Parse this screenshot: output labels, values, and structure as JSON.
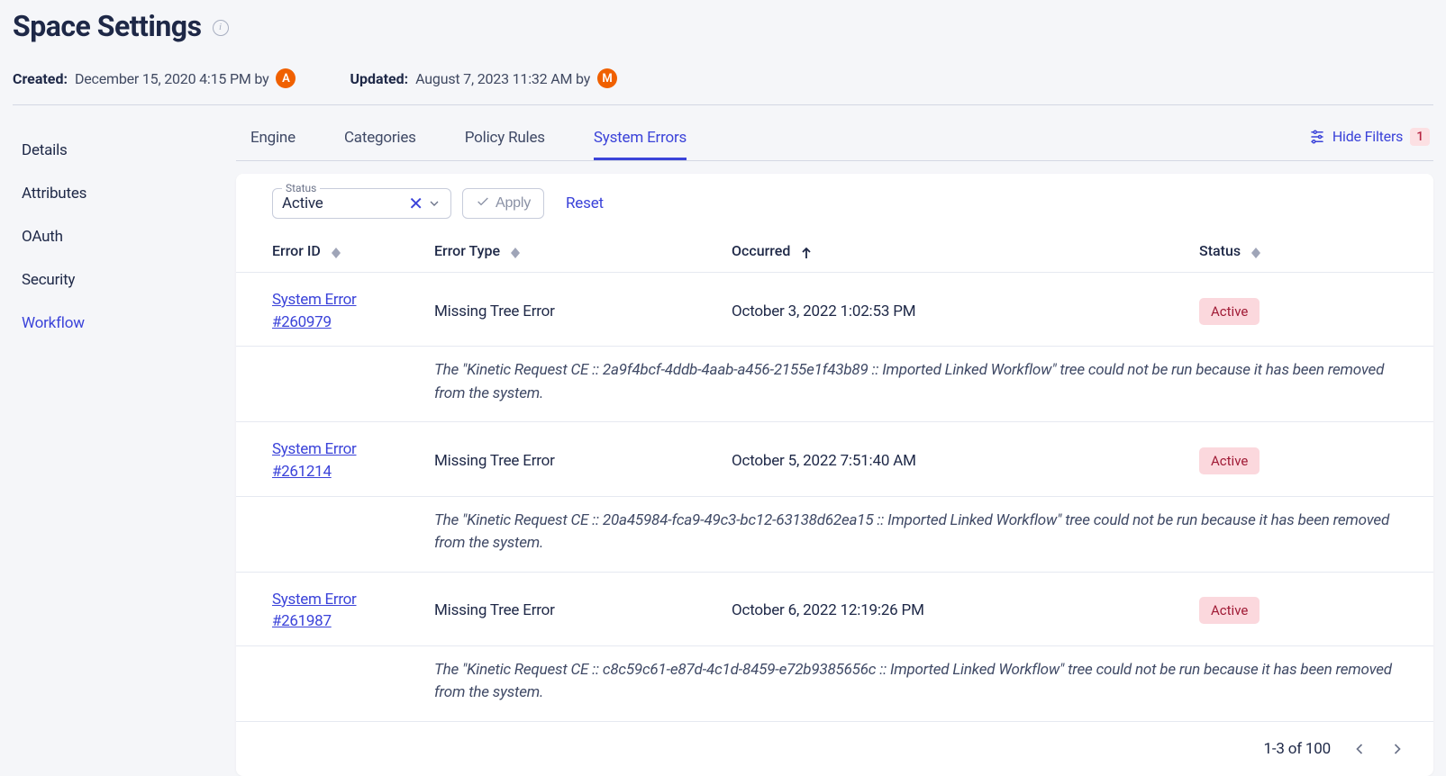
{
  "header": {
    "title": "Space Settings",
    "created_label": "Created:",
    "created_value": "December 15, 2020 4:15 PM by",
    "created_avatar": "A",
    "updated_label": "Updated:",
    "updated_value": "August 7, 2023 11:32 AM by",
    "updated_avatar": "M"
  },
  "sidebar": {
    "items": [
      {
        "label": "Details"
      },
      {
        "label": "Attributes"
      },
      {
        "label": "OAuth"
      },
      {
        "label": "Security"
      },
      {
        "label": "Workflow"
      }
    ]
  },
  "tabs": {
    "items": [
      {
        "label": "Engine"
      },
      {
        "label": "Categories"
      },
      {
        "label": "Policy Rules"
      },
      {
        "label": "System Errors"
      }
    ]
  },
  "filters": {
    "hide_label": "Hide Filters",
    "count": "1",
    "status_field_label": "Status",
    "status_value": "Active",
    "apply_label": "Apply",
    "reset_label": "Reset"
  },
  "table": {
    "headers": {
      "id": "Error ID",
      "type": "Error Type",
      "occurred": "Occurred",
      "status": "Status"
    },
    "rows": [
      {
        "link_line1": "System Error",
        "link_line2": "#260979",
        "type": "Missing Tree Error",
        "occurred": "October 3, 2022 1:02:53 PM",
        "status": "Active",
        "message": "The \"Kinetic Request CE :: 2a9f4bcf-4ddb-4aab-a456-2155e1f43b89 :: Imported Linked Workflow\" tree could not be run because it has been removed from the system."
      },
      {
        "link_line1": "System Error",
        "link_line2": "#261214",
        "type": "Missing Tree Error",
        "occurred": "October 5, 2022 7:51:40 AM",
        "status": "Active",
        "message": "The \"Kinetic Request CE :: 20a45984-fca9-49c3-bc12-63138d62ea15 :: Imported Linked Workflow\" tree could not be run because it has been removed from the system."
      },
      {
        "link_line1": "System Error",
        "link_line2": "#261987",
        "type": "Missing Tree Error",
        "occurred": "October 6, 2022 12:19:26 PM",
        "status": "Active",
        "message": "The \"Kinetic Request CE :: c8c59c61-e87d-4c1d-8459-e72b9385656c :: Imported Linked Workflow\" tree could not be run because it has been removed from the system."
      }
    ]
  },
  "pagination": {
    "range": "1-3 of 100"
  }
}
